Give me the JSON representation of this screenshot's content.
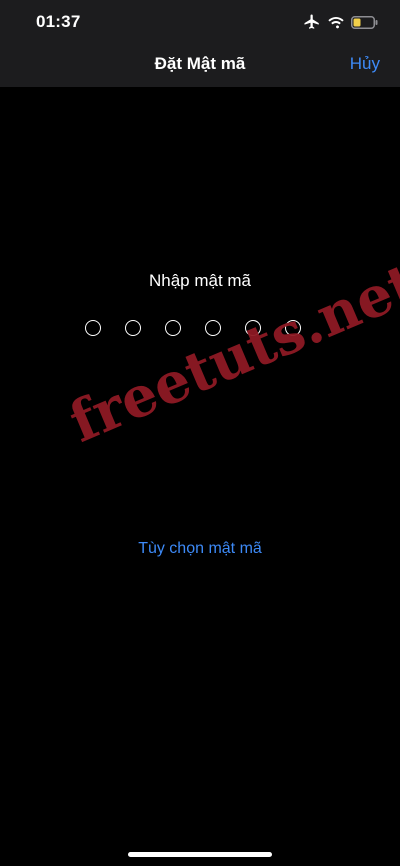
{
  "status_bar": {
    "time": "01:37",
    "icons": [
      "airplane-icon",
      "wifi-icon",
      "battery-icon"
    ],
    "battery_color": "#f2d04a"
  },
  "nav": {
    "title": "Đặt Mật mã",
    "cancel_label": "Hủy"
  },
  "passcode": {
    "prompt": "Nhập mật mã",
    "digit_count": 6,
    "options_label": "Tùy chọn mật mã"
  },
  "watermark": {
    "text": "freetuts.net",
    "color": "#8e1a24"
  },
  "colors": {
    "accent": "#3d8af7",
    "background": "#000000",
    "bar_background": "#1c1c1e"
  }
}
